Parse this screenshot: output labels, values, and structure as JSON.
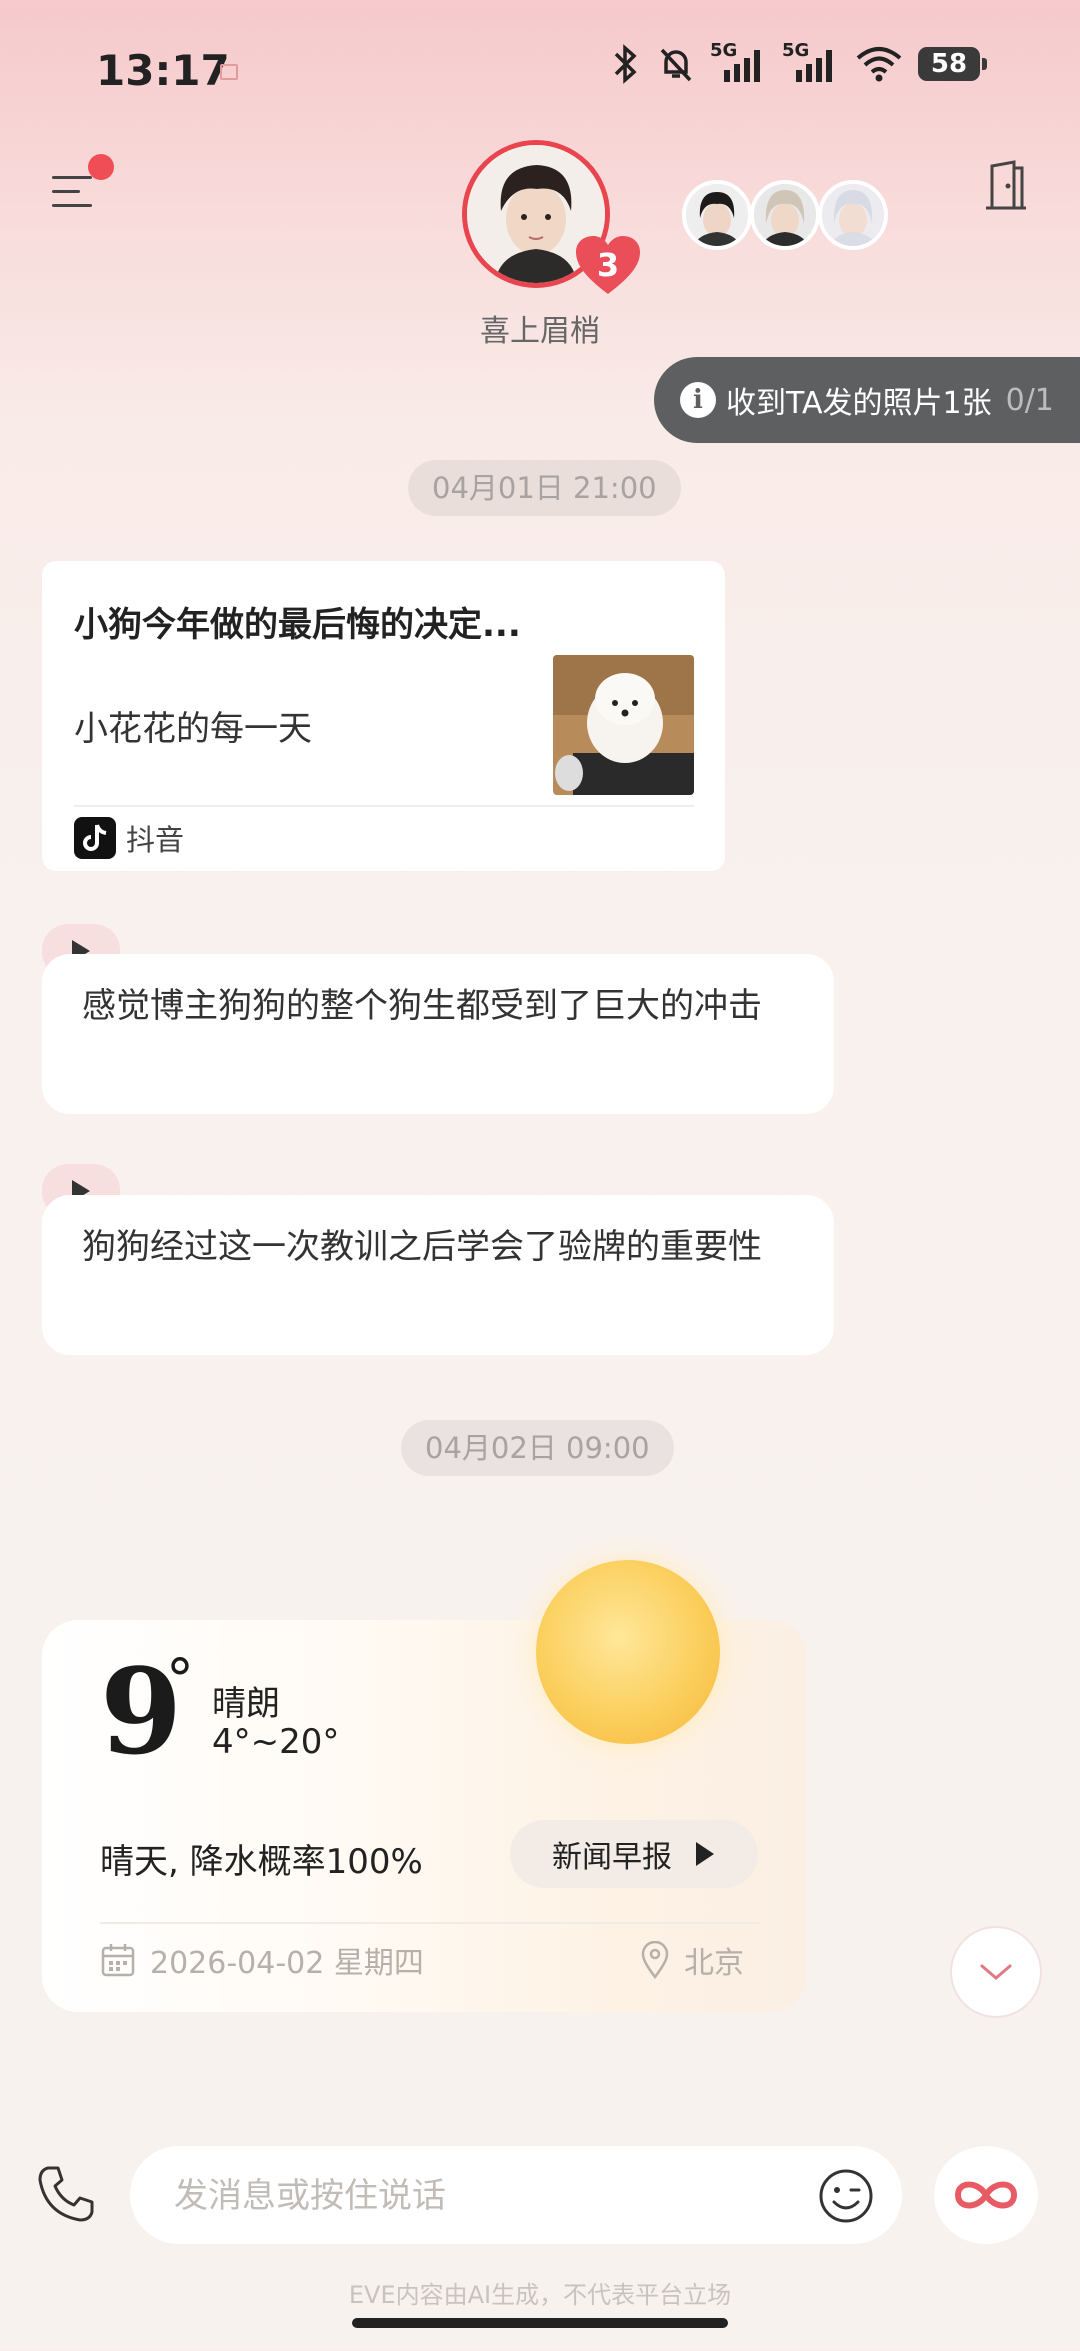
{
  "status_bar": {
    "time": "13:17",
    "network1": "5G",
    "network2": "5G",
    "battery": "58"
  },
  "header": {
    "contact_name": "喜上眉梢",
    "heart_count": "3",
    "photo_notice": "收到TA发的照片1张",
    "photo_notice_count": "0/1"
  },
  "messages": {
    "timestamp1": "04月01日 21:00",
    "share_card": {
      "title": "小狗今年做的最后悔的决定...",
      "subtitle": "小花花的每一天",
      "source": "抖音"
    },
    "bubble1": "感觉博主狗狗的整个狗生都受到了巨大的冲击",
    "bubble2": "狗狗经过这一次教训之后学会了验牌的重要性",
    "timestamp2": "04月02日 09:00"
  },
  "weather": {
    "temperature": "9",
    "degree_symbol": "°",
    "condition": "晴朗",
    "range": "4°~20°",
    "summary": "晴天, 降水概率100%",
    "news_button": "新闻早报",
    "date": "2026-04-02 星期四",
    "location": "北京"
  },
  "input": {
    "placeholder": "发消息或按住说话"
  },
  "footer": {
    "disclaimer": "EVE内容由AI生成，不代表平台立场"
  },
  "colors": {
    "accent": "#e9454f",
    "pill": "#5e5f60",
    "badge": "#f04e57"
  }
}
